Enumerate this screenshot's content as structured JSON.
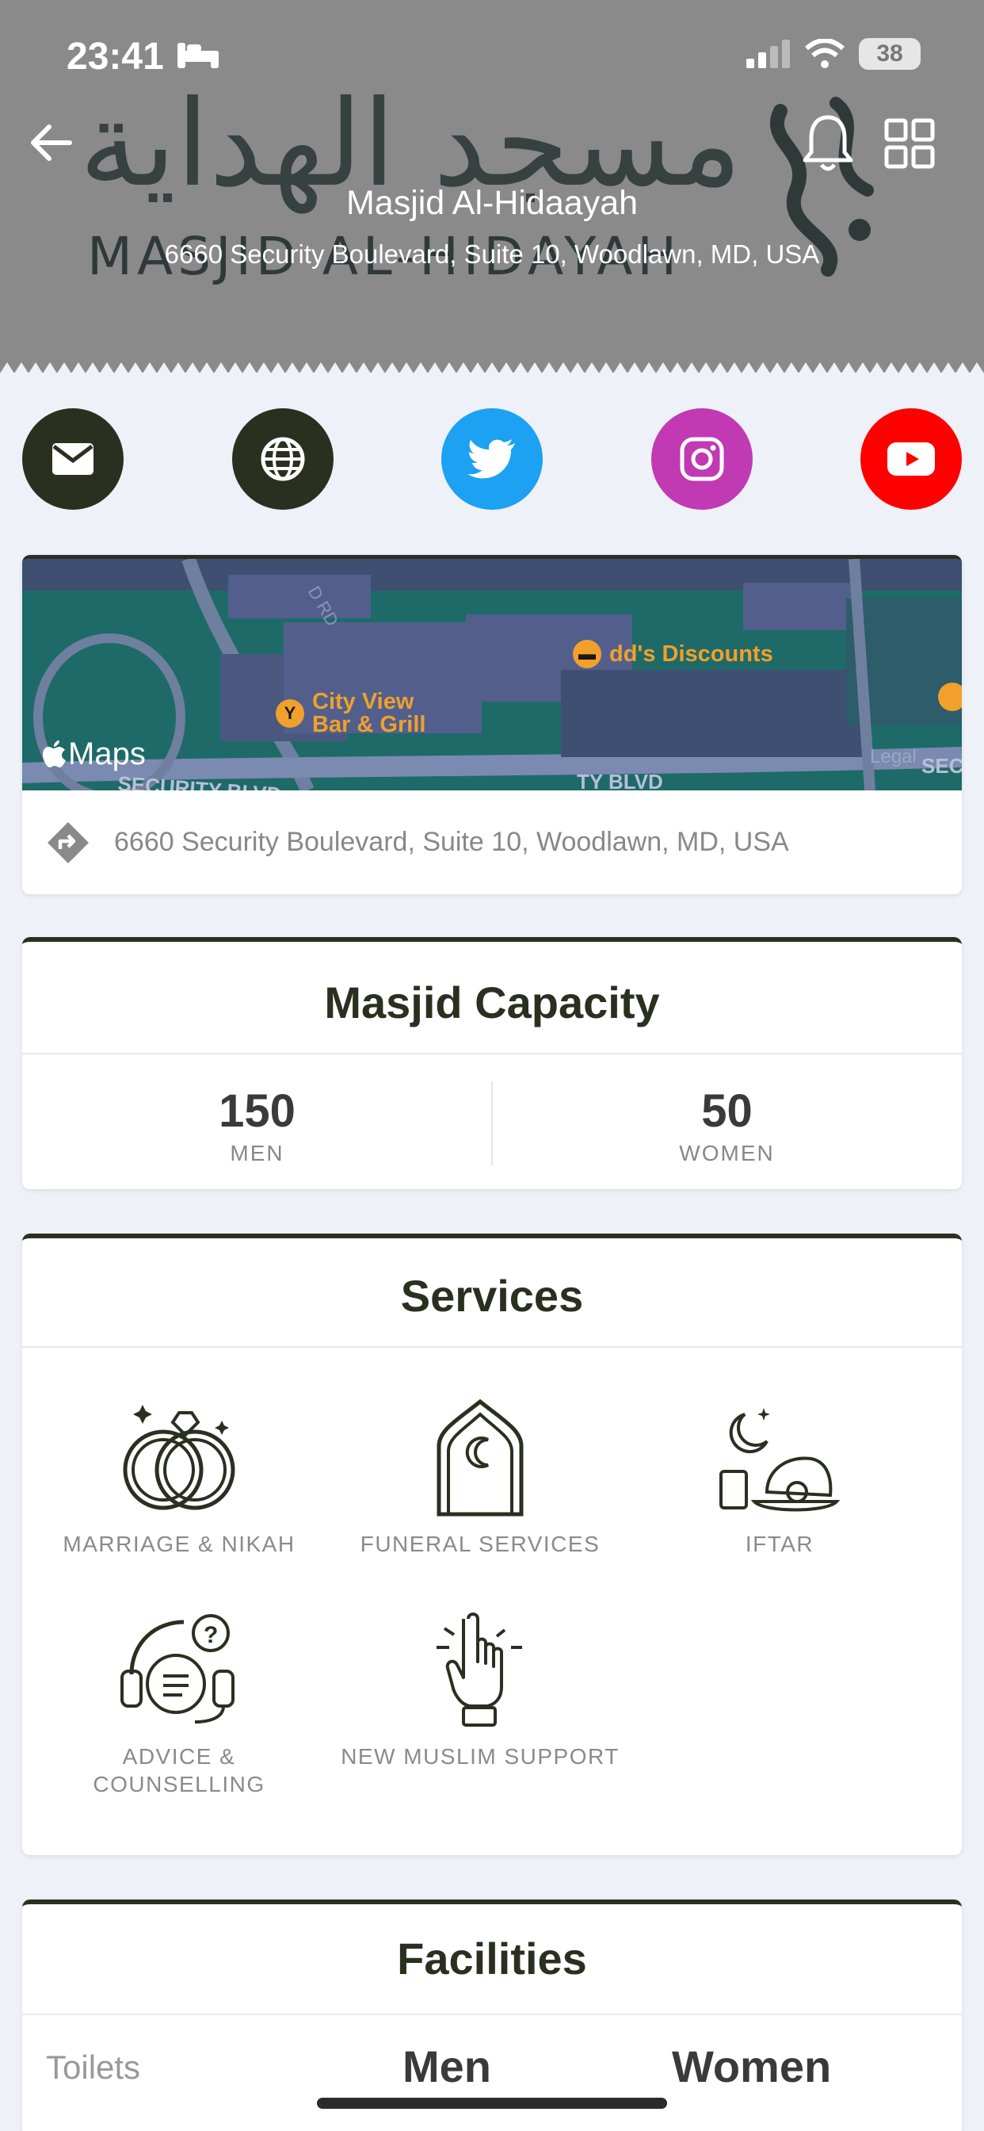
{
  "status_bar": {
    "time": "23:41",
    "battery": "38"
  },
  "header": {
    "name": "Masjid Al-Hidaayah",
    "address": "6660 Security Boulevard, Suite 10, Woodlawn, MD, USA",
    "logo_arabic": "مسجد الهداية",
    "logo_latin": "MASJID AL-HIDAYAH",
    "colors": {
      "background": "#8a8a8a",
      "logo": "#2f3a38"
    }
  },
  "social": [
    {
      "name": "email",
      "icon": "mail-icon",
      "color": "#2a3020"
    },
    {
      "name": "website",
      "icon": "globe-icon",
      "color": "#2a3020"
    },
    {
      "name": "twitter",
      "icon": "twitter-icon",
      "color": "#1da1f2"
    },
    {
      "name": "instagram",
      "icon": "instagram-icon",
      "color": "#c13ab3"
    },
    {
      "name": "youtube",
      "icon": "youtube-icon",
      "color": "#ff0000"
    }
  ],
  "map": {
    "brand": "Maps",
    "legal": "Legal",
    "streets": {
      "top": "D RD",
      "bottom_left": "SECURITY BLVD",
      "bottom_mid": "TY BLVD",
      "right": "SECU"
    },
    "pois": [
      {
        "label": "dd's Discounts",
        "icon": "bag-icon"
      },
      {
        "label_line1": "City View",
        "label_line2": "Bar & Grill",
        "icon": "cocktail-icon"
      }
    ],
    "address": "6660 Security Boulevard, Suite 10, Woodlawn, MD, USA"
  },
  "capacity": {
    "title": "Masjid Capacity",
    "men": {
      "value": "150",
      "label": "MEN"
    },
    "women": {
      "value": "50",
      "label": "WOMEN"
    }
  },
  "services": {
    "title": "Services",
    "items": [
      {
        "label": "MARRIAGE & NIKAH",
        "icon": "rings-icon"
      },
      {
        "label": "FUNERAL SERVICES",
        "icon": "mosque-door-icon"
      },
      {
        "label": "IFTAR",
        "icon": "iftar-meal-icon"
      },
      {
        "label_line1": "ADVICE &",
        "label_line2": "COUNSELLING",
        "icon": "headset-icon"
      },
      {
        "label": "NEW MUSLIM SUPPORT",
        "icon": "raised-finger-icon"
      }
    ]
  },
  "facilities": {
    "title": "Facilities",
    "row_label": "Toilets",
    "col_men": "Men",
    "col_women": "Women"
  }
}
